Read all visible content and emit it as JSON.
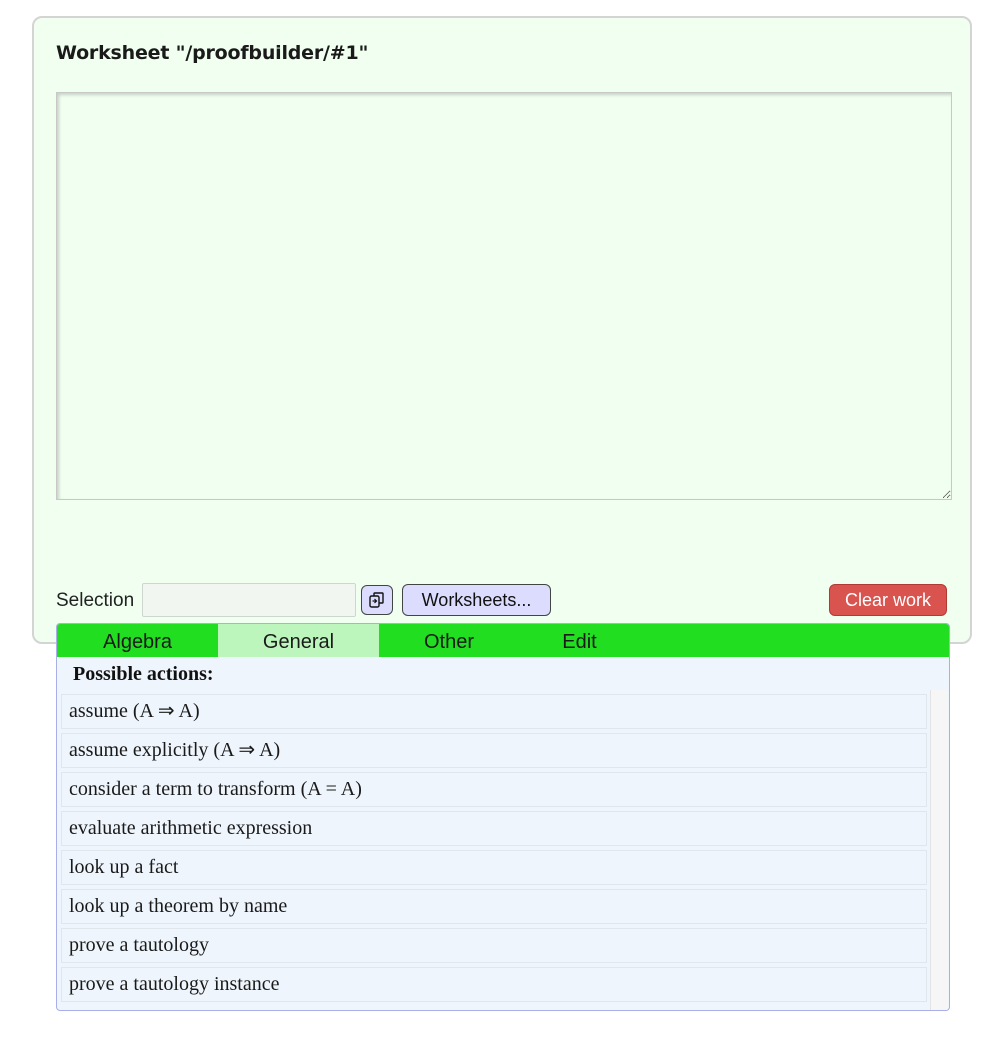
{
  "worksheet": {
    "title": "Worksheet \"/proofbuilder/#1\"",
    "work_text": ""
  },
  "toolbar": {
    "selection_label": "Selection",
    "selection_value": "",
    "copy_icon": "copy-icon",
    "worksheets_label": "Worksheets...",
    "clear_label": "Clear work"
  },
  "tabs": [
    {
      "label": "Algebra",
      "active": false
    },
    {
      "label": "General",
      "active": true
    },
    {
      "label": "Other",
      "active": false
    },
    {
      "label": "Edit",
      "active": false
    }
  ],
  "actions": {
    "heading": "Possible actions:",
    "items": [
      "assume (A ⇒ A)",
      "assume explicitly (A ⇒ A)",
      "consider a term to transform (A = A)",
      "evaluate arithmetic expression",
      "look up a fact",
      "look up a theorem by name",
      "prove a tautology",
      "prove a tautology instance"
    ]
  },
  "colors": {
    "panel_bg": "#f0fff0",
    "tab_bar": "#21de21",
    "tab_active": "#bdf6bd",
    "button_bg": "#dcdcff",
    "clear_button": "#d9534f",
    "actions_bg": "#eef5fc"
  }
}
